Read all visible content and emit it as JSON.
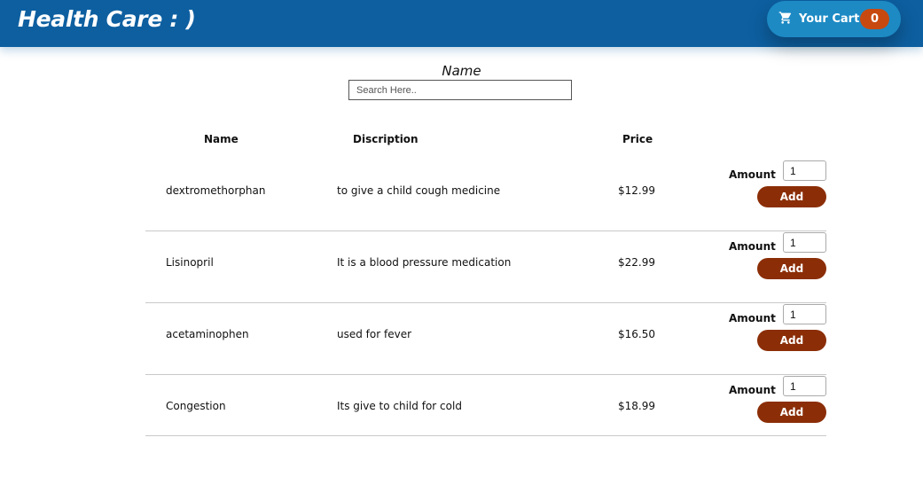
{
  "header": {
    "brand": "Health Care : )",
    "cart": {
      "icon": "shopping-cart-icon",
      "label": "Your Cart",
      "count": "0"
    }
  },
  "search": {
    "label": "Name",
    "placeholder": "Search Here.."
  },
  "table": {
    "columns": {
      "name": "Name",
      "description": "Discription",
      "price": "Price"
    },
    "amount_label": "Amount",
    "add_label": "Add",
    "rows": [
      {
        "name": "dextromethorphan",
        "description": "to give a child cough medicine",
        "price": "$12.99",
        "amount": "1"
      },
      {
        "name": "Lisinopril",
        "description": "It is a blood pressure medication",
        "price": "$22.99",
        "amount": "1"
      },
      {
        "name": "acetaminophen",
        "description": "used for fever",
        "price": "$16.50",
        "amount": "1"
      },
      {
        "name": "Congestion",
        "description": "Its give to child for cold",
        "price": "$18.99",
        "amount": "1"
      }
    ]
  },
  "colors": {
    "header": "#0d5fa0",
    "cart_button": "#1d8ac4",
    "cart_badge": "#c8490f",
    "add_button": "#8b2e07"
  }
}
